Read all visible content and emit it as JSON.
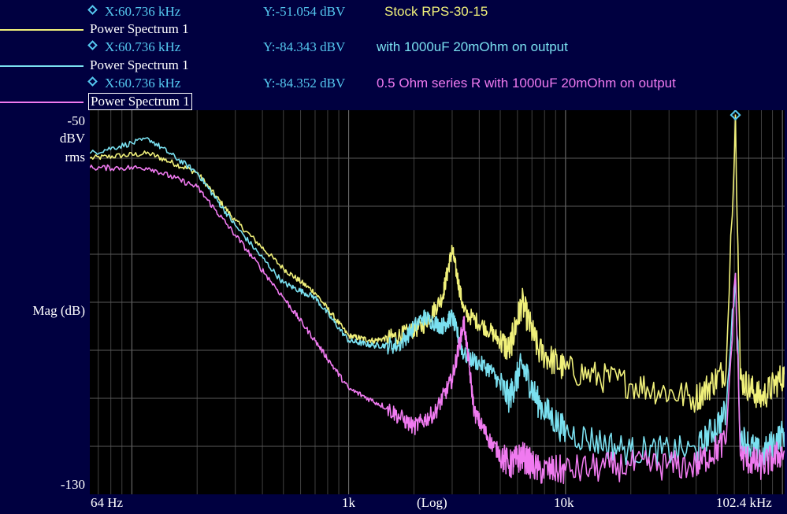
{
  "markers": [
    {
      "x": "X:60.736 kHz",
      "y": "Y:-51.054 dBV",
      "desc": "Stock RPS-30-15",
      "color": "#f0f07a"
    },
    {
      "x": "X:60.736 kHz",
      "y": "Y:-84.343 dBV",
      "desc": "with 1000uF 20mOhm on output",
      "color": "#7ae0f0"
    },
    {
      "x": "X:60.736 kHz",
      "y": "Y:-84.352 dBV",
      "desc": "0.5 Ohm series R with 1000uF 20mOhm on output",
      "color": "#f07af0"
    }
  ],
  "traces": [
    {
      "name": "Power Spectrum 1",
      "color": "#f0f07a"
    },
    {
      "name": "Power Spectrum 1",
      "color": "#7ae0f0"
    },
    {
      "name": "Power Spectrum 1",
      "color": "#f07af0"
    }
  ],
  "yaxis": {
    "top": "-50",
    "unit1": "dBV",
    "unit2": "rms",
    "label": "Mag (dB)",
    "bottom": "-130"
  },
  "xaxis": {
    "left": "64  Hz",
    "k1": "1k",
    "scale": "(Log)",
    "k10": "10k",
    "right": "102.4 kHz"
  },
  "chart_data": {
    "type": "line",
    "xscale": "log",
    "xlim": [
      64,
      102400
    ],
    "ylim": [
      -130,
      -50
    ],
    "ylabel": "Mag (dB)",
    "yunit": "dBV rms",
    "grid": true,
    "series": [
      {
        "name": "Stock RPS-30-15",
        "points": [
          [
            64,
            -60
          ],
          [
            120,
            -59
          ],
          [
            200,
            -63
          ],
          [
            300,
            -73
          ],
          [
            500,
            -83
          ],
          [
            700,
            -88
          ],
          [
            1000,
            -97
          ],
          [
            1300,
            -98
          ],
          [
            1700,
            -97
          ],
          [
            2200,
            -95
          ],
          [
            2700,
            -89
          ],
          [
            3000,
            -79
          ],
          [
            3400,
            -92
          ],
          [
            4500,
            -96
          ],
          [
            5500,
            -100
          ],
          [
            6300,
            -90
          ],
          [
            7500,
            -100
          ],
          [
            10000,
            -104
          ],
          [
            20000,
            -107
          ],
          [
            40000,
            -110
          ],
          [
            55000,
            -104
          ],
          [
            60736,
            -51
          ],
          [
            64000,
            -106
          ],
          [
            80000,
            -110
          ],
          [
            102400,
            -105
          ]
        ]
      },
      {
        "name": "with 1000uF 20mOhm on output",
        "points": [
          [
            64,
            -59
          ],
          [
            120,
            -56
          ],
          [
            200,
            -63
          ],
          [
            300,
            -74
          ],
          [
            500,
            -86
          ],
          [
            700,
            -89
          ],
          [
            1000,
            -98
          ],
          [
            1300,
            -99
          ],
          [
            1700,
            -99
          ],
          [
            2200,
            -93
          ],
          [
            2700,
            -95
          ],
          [
            3000,
            -93
          ],
          [
            3400,
            -101
          ],
          [
            4500,
            -104
          ],
          [
            5500,
            -110
          ],
          [
            6300,
            -103
          ],
          [
            7500,
            -111
          ],
          [
            10000,
            -117
          ],
          [
            20000,
            -121
          ],
          [
            40000,
            -121
          ],
          [
            55000,
            -113
          ],
          [
            60736,
            -84
          ],
          [
            64000,
            -118
          ],
          [
            80000,
            -122
          ],
          [
            102400,
            -117
          ]
        ]
      },
      {
        "name": "0.5 Ohm series R with 1000uF 20mOhm on output",
        "points": [
          [
            64,
            -62
          ],
          [
            120,
            -62
          ],
          [
            200,
            -66
          ],
          [
            300,
            -76
          ],
          [
            500,
            -89
          ],
          [
            700,
            -98
          ],
          [
            1000,
            -108
          ],
          [
            1500,
            -112
          ],
          [
            2000,
            -116
          ],
          [
            2500,
            -113
          ],
          [
            3000,
            -106
          ],
          [
            3400,
            -94
          ],
          [
            3800,
            -113
          ],
          [
            4500,
            -119
          ],
          [
            5500,
            -124
          ],
          [
            6300,
            -122
          ],
          [
            7500,
            -125
          ],
          [
            10000,
            -125
          ],
          [
            20000,
            -124
          ],
          [
            40000,
            -124
          ],
          [
            55000,
            -119
          ],
          [
            60736,
            -84
          ],
          [
            64000,
            -122
          ],
          [
            80000,
            -124
          ],
          [
            102400,
            -121
          ]
        ]
      }
    ],
    "marker": {
      "x_khz": 60.736
    }
  }
}
